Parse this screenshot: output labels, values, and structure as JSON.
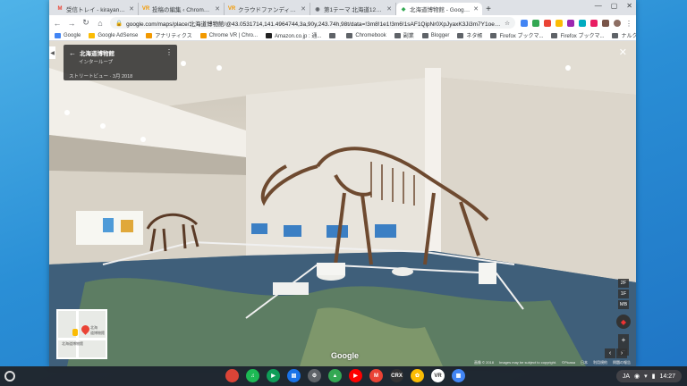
{
  "tabs": [
    {
      "label": "受信トレイ - kirayan4652@gmai",
      "fav": "M",
      "favcolor": "#ea4335",
      "active": false
    },
    {
      "label": "投稿の編集 ‹ Chrome VR — Wo",
      "fav": "VR",
      "favcolor": "#f29900",
      "active": false
    },
    {
      "label": "クラウドファンディングでA",
      "fav": "VR",
      "favcolor": "#f29900",
      "active": false
    },
    {
      "label": "第1テーマ 北海道120万年物語",
      "fav": "◉",
      "favcolor": "#5f6368",
      "active": false
    },
    {
      "label": "北海道博物館 - Google マップ",
      "fav": "◆",
      "favcolor": "#34a853",
      "active": true
    }
  ],
  "newtab": "+",
  "window_controls": {
    "minimize": "—",
    "maximize": "▢",
    "close": "✕"
  },
  "toolbar": {
    "back": "←",
    "forward": "→",
    "reload": "↻",
    "home": "⌂",
    "url": "google.com/maps/place/北海道博物館/@43.0531714,141.4964744,3a,90y,243.74h,98t/data=!3m8!1e1!3m6!1sAF1QipNr0XpJyaxK3Ji3m7Y1oeLCsB5Om..."
  },
  "bookmarks": [
    {
      "label": "Google",
      "color": "#4285f4"
    },
    {
      "label": "Google AdSense",
      "color": "#fbbc04"
    },
    {
      "label": "アナリティクス",
      "color": "#f29900"
    },
    {
      "label": "Chrome VR | Chro...",
      "color": "#f29900"
    },
    {
      "label": "Amazon.co.jp : 通...",
      "color": "#222222"
    },
    {
      "label": "",
      "color": "#5f6368"
    },
    {
      "label": "Chromebook",
      "color": "#5f6368"
    },
    {
      "label": "副業",
      "color": "#5f6368"
    },
    {
      "label": "Blogger",
      "color": "#5f6368"
    },
    {
      "label": "ネタ帳",
      "color": "#5f6368"
    },
    {
      "label": "Firefox ブックマ...",
      "color": "#5f6368"
    },
    {
      "label": "Firefox ブックマ...",
      "color": "#5f6368"
    },
    {
      "label": "ナルク札幌",
      "color": "#5f6368"
    },
    {
      "label": "»",
      "color": "transparent"
    },
    {
      "label": "その他のブックマーク",
      "color": "#5f6368"
    }
  ],
  "streetview": {
    "place_name": "北海道博物館",
    "place_sub": "インターループ",
    "date": "ストリートビュー · 3月 2018",
    "close": "✕",
    "google": "Google",
    "footer": [
      "画像 © 2018",
      "Images may be subject to copyright.",
      "©Picasa",
      "日本",
      "利用規約",
      "問題の報告"
    ],
    "floors": [
      "2F",
      "1F",
      "MB"
    ],
    "zoom_in": "+",
    "zoom_out": "−",
    "prev": "‹",
    "next": "›"
  },
  "minimap": {
    "label_a": "北海道博物館",
    "label_b": "道博物館",
    "label_c": "北海"
  },
  "shelf": {
    "apps": [
      {
        "name": "chrome",
        "glyph": "",
        "color": "#db4437"
      },
      {
        "name": "spotify",
        "glyph": "♫",
        "color": "#1db954"
      },
      {
        "name": "play-store",
        "glyph": "▶",
        "color": "#0f9d58"
      },
      {
        "name": "files",
        "glyph": "▤",
        "color": "#1a73e8"
      },
      {
        "name": "settings",
        "glyph": "⚙",
        "color": "#5f6368"
      },
      {
        "name": "drive",
        "glyph": "▲",
        "color": "#34a853"
      },
      {
        "name": "youtube",
        "glyph": "▶",
        "color": "#ff0000"
      },
      {
        "name": "gmail",
        "glyph": "M",
        "color": "#ea4335"
      },
      {
        "name": "terminal",
        "glyph": "CRX",
        "color": "#333333"
      },
      {
        "name": "photos",
        "glyph": "✿",
        "color": "#fbbc04"
      },
      {
        "name": "vr",
        "glyph": "VR",
        "color": "#ffffff"
      },
      {
        "name": "store",
        "glyph": "▦",
        "color": "#4285f4"
      }
    ],
    "ime": "JA",
    "time": "14:27"
  }
}
